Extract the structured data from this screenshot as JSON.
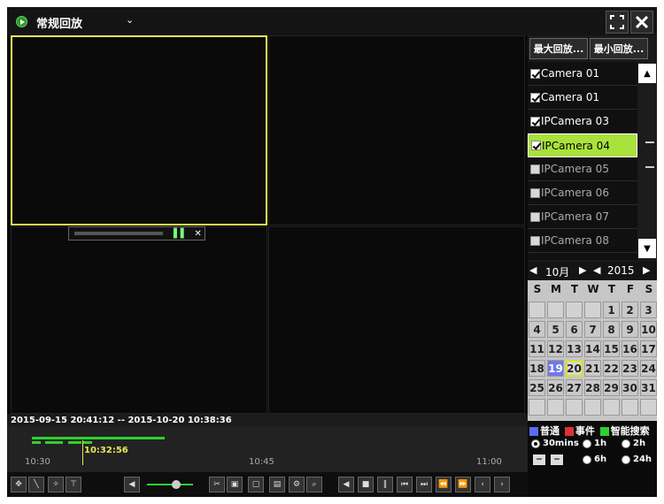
{
  "header": {
    "title": "常规回放",
    "dropdown_icon": "chevron-down-icon",
    "fullscreen_icon": "fullscreen-icon",
    "close_icon": "close-icon"
  },
  "panel": {
    "max_btn": "最大回放...",
    "min_btn": "最小回放..."
  },
  "cameras": [
    {
      "label": "Camera 01",
      "checked": true,
      "selected": false
    },
    {
      "label": "Camera 01",
      "checked": true,
      "selected": false
    },
    {
      "label": "IPCamera 03",
      "checked": true,
      "selected": false
    },
    {
      "label": "IPCamera 04",
      "checked": true,
      "selected": true
    },
    {
      "label": "IPCamera 05",
      "checked": false,
      "selected": false
    },
    {
      "label": "IPCamera 06",
      "checked": false,
      "selected": false
    },
    {
      "label": "IPCamera 07",
      "checked": false,
      "selected": false
    },
    {
      "label": "IPCamera 08",
      "checked": false,
      "selected": false
    }
  ],
  "calendar": {
    "month": "10月",
    "year": "2015",
    "weekdays": [
      "S",
      "M",
      "T",
      "W",
      "T",
      "F",
      "S"
    ],
    "weeks": [
      [
        "",
        "",
        "",
        "",
        "1",
        "2",
        "3"
      ],
      [
        "4",
        "5",
        "6",
        "7",
        "8",
        "9",
        "10"
      ],
      [
        "11",
        "12",
        "13",
        "14",
        "15",
        "16",
        "17"
      ],
      [
        "18",
        "19",
        "20",
        "21",
        "22",
        "23",
        "24"
      ],
      [
        "25",
        "26",
        "27",
        "28",
        "29",
        "30",
        "31"
      ],
      [
        "",
        "",
        "",
        "",
        "",
        "",
        ""
      ]
    ],
    "highlight_day": "19",
    "today": "20"
  },
  "timeline": {
    "range": "2015-09-15 20:41:12 -- 2015-10-20 10:38:36",
    "cursor_time": "10:32:56",
    "ticks": [
      "10:30",
      "10:45",
      "11:00"
    ],
    "cursor_fraction": 0.11
  },
  "legend": {
    "normal": "普通",
    "event": "事件",
    "smart": "智能搜索",
    "colors": {
      "normal": "#5a6cf0",
      "event": "#e03030",
      "smart": "#2fd02f"
    }
  },
  "zoom": {
    "options": [
      "30mins",
      "1h",
      "2h",
      "6h",
      "24h"
    ],
    "selected": "30mins"
  }
}
